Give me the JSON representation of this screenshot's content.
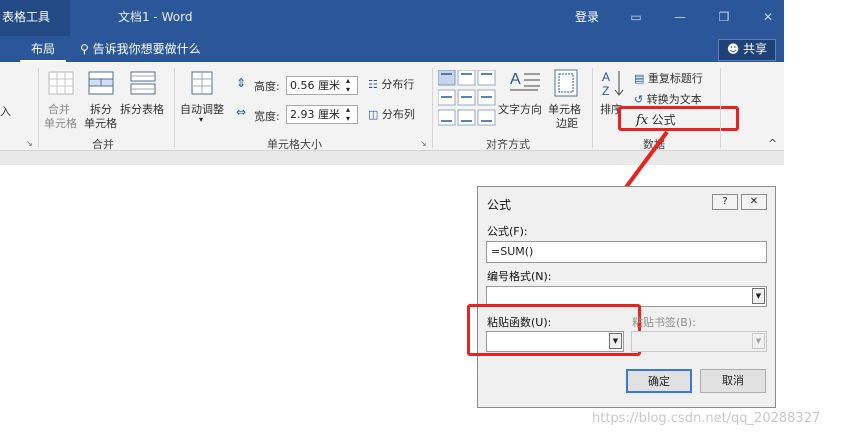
{
  "titlebar": {
    "context_tab": "表格工具",
    "title": "文档1  -  Word",
    "login": "登录",
    "restore_glyph": "▭",
    "minimize_glyph": "—",
    "maximize_glyph": "❐",
    "close_glyph": "✕"
  },
  "tabs": {
    "active": "布局",
    "tell_me": "告诉我你想要做什么",
    "share": "共享"
  },
  "ribbon": {
    "partial_insert": "入",
    "merge_cells_l1": "合并",
    "merge_cells_l2": "单元格",
    "split_cells_l1": "拆分",
    "split_cells_l2": "单元格",
    "split_table": "拆分表格",
    "merge_group": "合并",
    "autofit": "自动调整",
    "height_label": "高度:",
    "height_value": "0.56 厘米",
    "width_label": "宽度:",
    "width_value": "2.93 厘米",
    "distribute_rows": "分布行",
    "distribute_cols": "分布列",
    "cell_size_group": "单元格大小",
    "text_direction": "文字方向",
    "cell_margins_l1": "单元格",
    "cell_margins_l2": "边距",
    "align_group": "对齐方式",
    "sort": "排序",
    "repeat_header": "重复标题行",
    "convert_text": "转换为文本",
    "formula": "公式",
    "data_group": "数据",
    "collapse_glyph": "^"
  },
  "dialog": {
    "title": "公式",
    "help_glyph": "?",
    "close_glyph": "✕",
    "formula_label": "公式(F):",
    "formula_value": "=SUM()",
    "number_format_label": "编号格式(N):",
    "number_format_value": "",
    "paste_function_label": "粘贴函数(U):",
    "paste_function_value": "",
    "paste_bookmark_label": "粘贴书签(B):",
    "paste_bookmark_value": "",
    "ok": "确定",
    "cancel": "取消"
  },
  "watermark": "https://blog.csdn.net/qq_20288327",
  "colors": {
    "word_blue": "#2b579a",
    "highlight_red": "#e8231f"
  }
}
